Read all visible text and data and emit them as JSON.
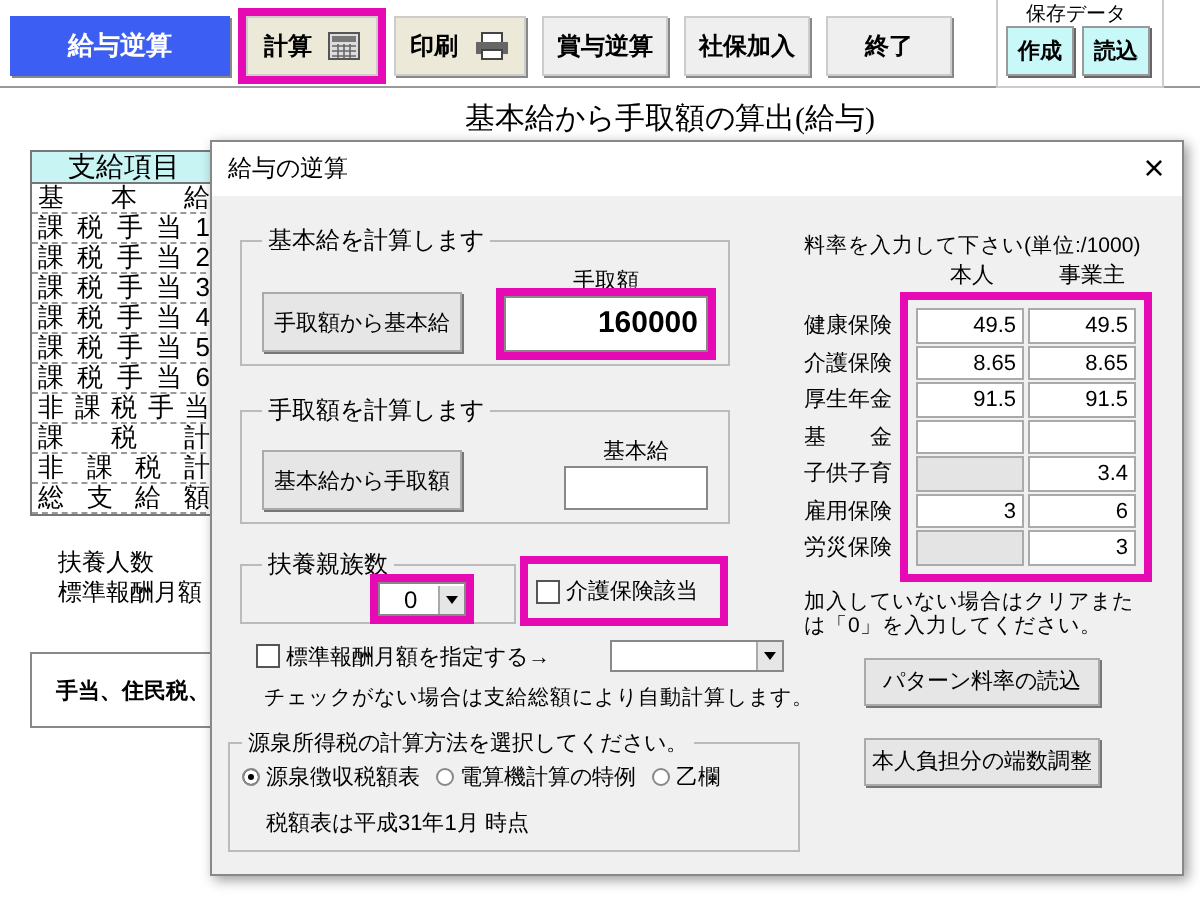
{
  "toolbar": {
    "buttons": [
      {
        "label": "給与逆算",
        "kind": "primary",
        "highlighted": false
      },
      {
        "label": "計算",
        "kind": "calculator",
        "highlighted": true
      },
      {
        "label": "印刷",
        "kind": "printer",
        "highlighted": false
      },
      {
        "label": "賞与逆算",
        "kind": "plain",
        "highlighted": false
      },
      {
        "label": "社保加入",
        "kind": "plain",
        "highlighted": false
      },
      {
        "label": "終了",
        "kind": "plain",
        "highlighted": false
      }
    ],
    "save_data": {
      "title": "保存データ",
      "buttons": [
        "作成",
        "読込"
      ]
    }
  },
  "page_title": "基本給から手取額の算出(給与)",
  "pay_table": {
    "header": "支給項目",
    "rows": [
      "基本給",
      "課税手当1",
      "課税手当2",
      "課税手当3",
      "課税手当4",
      "課税手当5",
      "課税手当6",
      "非課税手当",
      "課税計",
      "非課税計",
      "総支給額"
    ]
  },
  "labels": [
    "扶養人数",
    "標準報酬月額"
  ],
  "note_box": "手当、住民税、",
  "dialog": {
    "title": "給与の逆算",
    "close": "×",
    "basic_group": {
      "title": "基本給を計算します",
      "button": "手取額から基本給",
      "field_label": "手取額",
      "value": "160000",
      "highlighted": true
    },
    "takehome_group": {
      "title": "手取額を計算します",
      "button": "基本給から手取額",
      "field_label": "基本給"
    },
    "dependents": {
      "title": "扶養親族数",
      "value": "0",
      "highlighted": true
    },
    "nursing": {
      "label": "介護保険該当",
      "checked": false,
      "highlighted": true
    },
    "standard": {
      "label": "標準報酬月額を指定する→",
      "checked": false
    },
    "auto_note": "チェックがない場合は支給総額により自動計算します。",
    "tax_method": {
      "title": "源泉所得税の計算方法を選択してください。",
      "options": [
        {
          "label": "源泉徴収税額表",
          "selected": true
        },
        {
          "label": "電算機計算の特例",
          "selected": false
        },
        {
          "label": "乙欄",
          "selected": false
        }
      ],
      "note": "税額表は平成31年1月 時点"
    },
    "rates": {
      "title": "料率を入力して下さい(単位:/1000)",
      "columns": [
        "本人",
        "事業主"
      ],
      "highlighted": true,
      "rows": [
        {
          "label": "健康保険",
          "cells": [
            {
              "value": "49.5",
              "disabled": false
            },
            {
              "value": "49.5",
              "disabled": false
            }
          ]
        },
        {
          "label": "介護保険",
          "cells": [
            {
              "value": "8.65",
              "disabled": false
            },
            {
              "value": "8.65",
              "disabled": false
            }
          ]
        },
        {
          "label": "厚生年金",
          "cells": [
            {
              "value": "91.5",
              "disabled": false
            },
            {
              "value": "91.5",
              "disabled": false
            }
          ]
        },
        {
          "label": "基　　金",
          "cells": [
            {
              "disabled": false
            },
            {
              "disabled": false
            }
          ]
        },
        {
          "label": "子供子育",
          "cells": [
            {
              "disabled": true
            },
            {
              "value": "3.4",
              "disabled": false
            }
          ]
        },
        {
          "label": "雇用保険",
          "cells": [
            {
              "value": "3",
              "disabled": false
            },
            {
              "value": "6",
              "disabled": false
            }
          ]
        },
        {
          "label": "労災保険",
          "cells": [
            {
              "disabled": true
            },
            {
              "value": "3",
              "disabled": false
            }
          ]
        }
      ]
    },
    "rates_note": "加入していない場合はクリアまたは「0」を入力してください。",
    "buttons": [
      "パターン料率の読込",
      "本人負担分の端数調整"
    ]
  }
}
